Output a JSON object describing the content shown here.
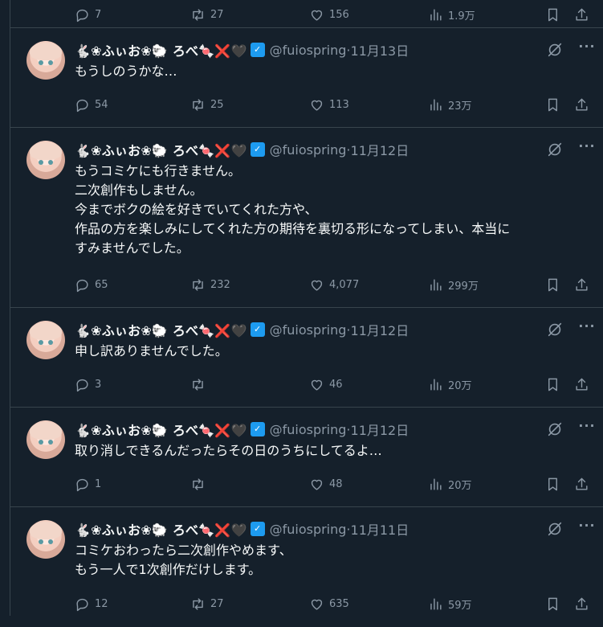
{
  "top_actions": {
    "replies": "7",
    "retweets": "27",
    "likes": "156",
    "views": "1.9万"
  },
  "tweets": [
    {
      "name": "🐇❀ふぃお❀🐑 ろべ🍬❌🖤",
      "handle": "@fuiospring",
      "date": "11月13日",
      "text": "もうしのうかな…",
      "replies": "54",
      "retweets": "25",
      "likes": "113",
      "views": "23万"
    },
    {
      "name": "🐇❀ふぃお❀🐑 ろべ🍬❌🖤",
      "handle": "@fuiospring",
      "date": "11月12日",
      "text": "もうコミケにも行きません。\n二次創作もしません。\n今までボクの絵を好きでいてくれた方や、\n作品の方を楽しみにしてくれた方の期待を裏切る形になってしまい、本当に\nすみませんでした。",
      "replies": "65",
      "retweets": "232",
      "likes": "4,077",
      "views": "299万"
    },
    {
      "name": "🐇❀ふぃお❀🐑 ろべ🍬❌🖤",
      "handle": "@fuiospring",
      "date": "11月12日",
      "text": "申し訳ありませんでした。",
      "replies": "3",
      "retweets": "",
      "likes": "46",
      "views": "20万"
    },
    {
      "name": "🐇❀ふぃお❀🐑 ろべ🍬❌🖤",
      "handle": "@fuiospring",
      "date": "11月12日",
      "text": "取り消しできるんだったらその日のうちにしてるよ…",
      "replies": "1",
      "retweets": "",
      "likes": "48",
      "views": "20万"
    },
    {
      "name": "🐇❀ふぃお❀🐑 ろべ🍬❌🖤",
      "handle": "@fuiospring",
      "date": "11月11日",
      "text": "コミケおわったら二次創作やめます、\nもう一人で1次創作だけします。",
      "replies": "12",
      "retweets": "27",
      "likes": "635",
      "views": "59万"
    }
  ],
  "separator": " · ",
  "icons": [
    "reply-icon",
    "retweet-icon",
    "like-icon",
    "views-icon",
    "bookmark-icon",
    "share-icon",
    "grok-icon",
    "more-icon",
    "verified-badge"
  ],
  "colors": {
    "background": "#15202b",
    "border": "#38444d",
    "muted": "#8b98a5",
    "text": "#f7f9f9",
    "accent": "#1d9bf0"
  }
}
